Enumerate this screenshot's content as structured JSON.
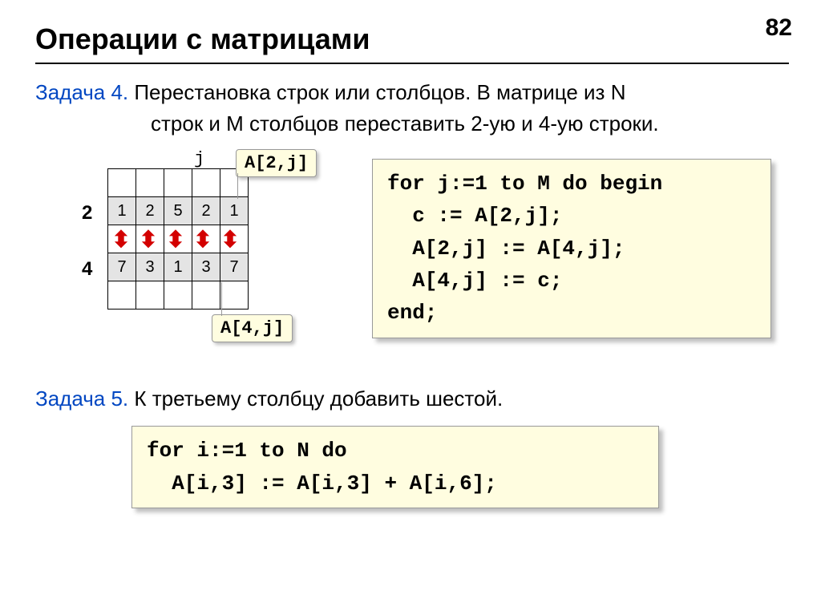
{
  "page_number": "82",
  "title": "Операции с матрицами",
  "task4": {
    "label": "Задача 4.",
    "line1": " Перестановка строк или столбцов. В матрице из N",
    "line2": "строк и M столбцов переставить 2-ую и 4-ую строки."
  },
  "figure": {
    "j_label": "j",
    "row2_label": "2",
    "row4_label": "4",
    "callout_top": "A[2,j]",
    "callout_bot": "A[4,j]",
    "row2_values": [
      "1",
      "2",
      "5",
      "2",
      "1"
    ],
    "row4_values": [
      "7",
      "3",
      "1",
      "3",
      "7"
    ]
  },
  "code1": "for j:=1 to M do begin\n  c := A[2,j];\n  A[2,j] := A[4,j];\n  A[4,j] := c;\nend;",
  "task5": {
    "label": "Задача 5.",
    "text": " К третьему столбцу добавить шестой."
  },
  "code2": "for i:=1 to N do\n  A[i,3] := A[i,3] + A[i,6];"
}
